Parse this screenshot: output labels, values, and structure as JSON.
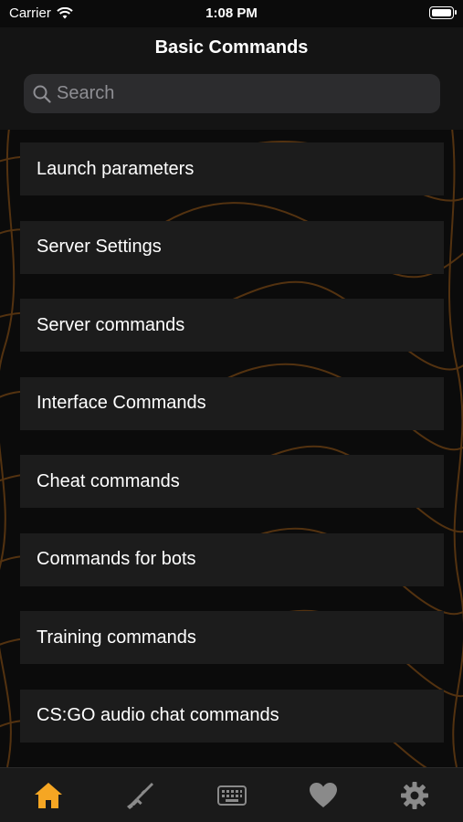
{
  "status_bar": {
    "carrier": "Carrier",
    "time": "1:08 PM"
  },
  "header": {
    "title": "Basic Commands"
  },
  "search": {
    "placeholder": "Search"
  },
  "items": [
    {
      "label": "Launch parameters"
    },
    {
      "label": "Server Settings"
    },
    {
      "label": "Server commands"
    },
    {
      "label": "Interface Commands"
    },
    {
      "label": "Cheat commands"
    },
    {
      "label": "Commands for bots"
    },
    {
      "label": "Training commands"
    },
    {
      "label": "CS:GO audio chat commands"
    }
  ],
  "tab_bar": {
    "tabs": [
      {
        "icon": "home-icon",
        "active": true
      },
      {
        "icon": "rifle-icon",
        "active": false
      },
      {
        "icon": "keyboard-icon",
        "active": false
      },
      {
        "icon": "heart-icon",
        "active": false
      },
      {
        "icon": "gear-icon",
        "active": false
      }
    ]
  },
  "colors": {
    "accent": "#f5a623",
    "inactive_icon": "#8a8a8a",
    "cell_bg": "#1c1c1c",
    "pattern": "#6b3f12"
  }
}
